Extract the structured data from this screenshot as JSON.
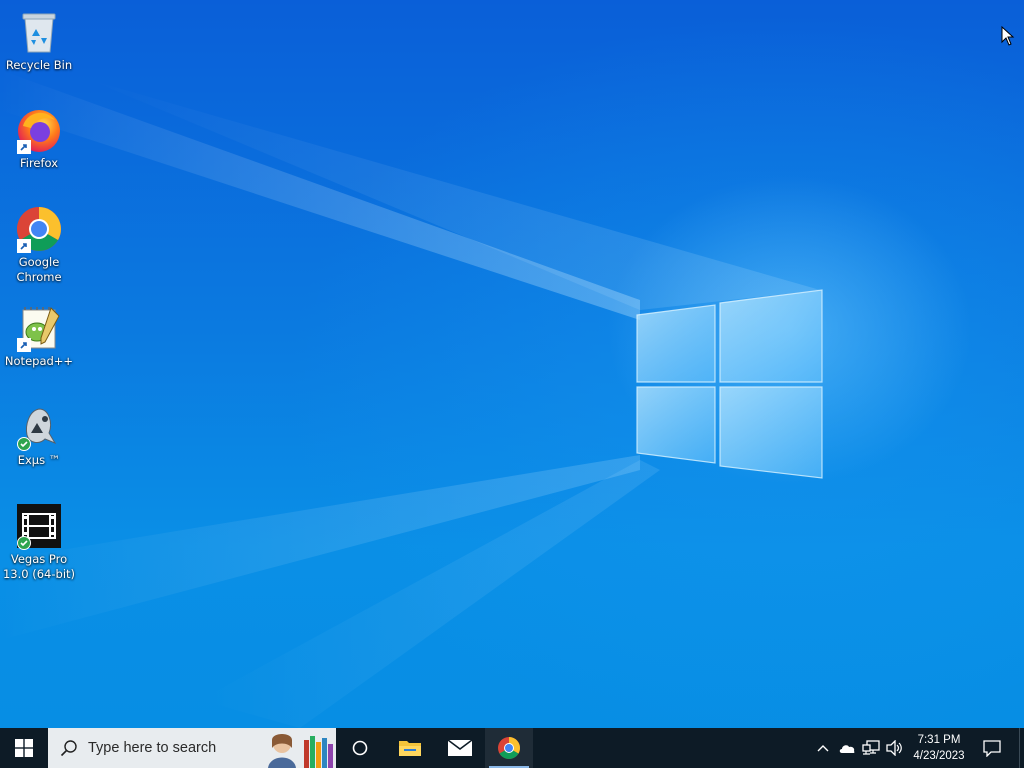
{
  "desktop": {
    "icons": [
      {
        "label": "Recycle Bin",
        "icon": "recycle-bin-icon"
      },
      {
        "label": "Firefox",
        "icon": "firefox-icon"
      },
      {
        "label": "Google Chrome",
        "icon": "chrome-icon"
      },
      {
        "label": "Notepad++",
        "icon": "notepad-plus-plus-icon"
      },
      {
        "label": "Exμs ™",
        "icon": "exus-icon"
      },
      {
        "label": "Vegas Pro 13.0 (64-bit)",
        "icon": "vegas-pro-icon"
      }
    ],
    "wallpaper": "windows-10-hero-light",
    "colors": {
      "accent": "#0a78e0",
      "taskbar": "#0d1b26",
      "search_bg": "#e8ecef"
    }
  },
  "taskbar": {
    "start_icon": "windows-logo-icon",
    "search": {
      "placeholder": "Type here to search",
      "icon": "search-icon"
    },
    "pinned": [
      {
        "name": "Cortana",
        "icon": "cortana-circle-icon"
      },
      {
        "name": "File Explorer",
        "icon": "folder-icon"
      },
      {
        "name": "Mail",
        "icon": "mail-icon"
      },
      {
        "name": "Google Chrome",
        "icon": "chrome-icon",
        "active": true
      }
    ],
    "tray": {
      "icons": [
        "chevron-up-icon",
        "onedrive-cloud-icon",
        "network-icon",
        "volume-icon"
      ],
      "time": "7:31 PM",
      "date": "4/23/2023",
      "notification_icon": "action-center-icon"
    }
  }
}
